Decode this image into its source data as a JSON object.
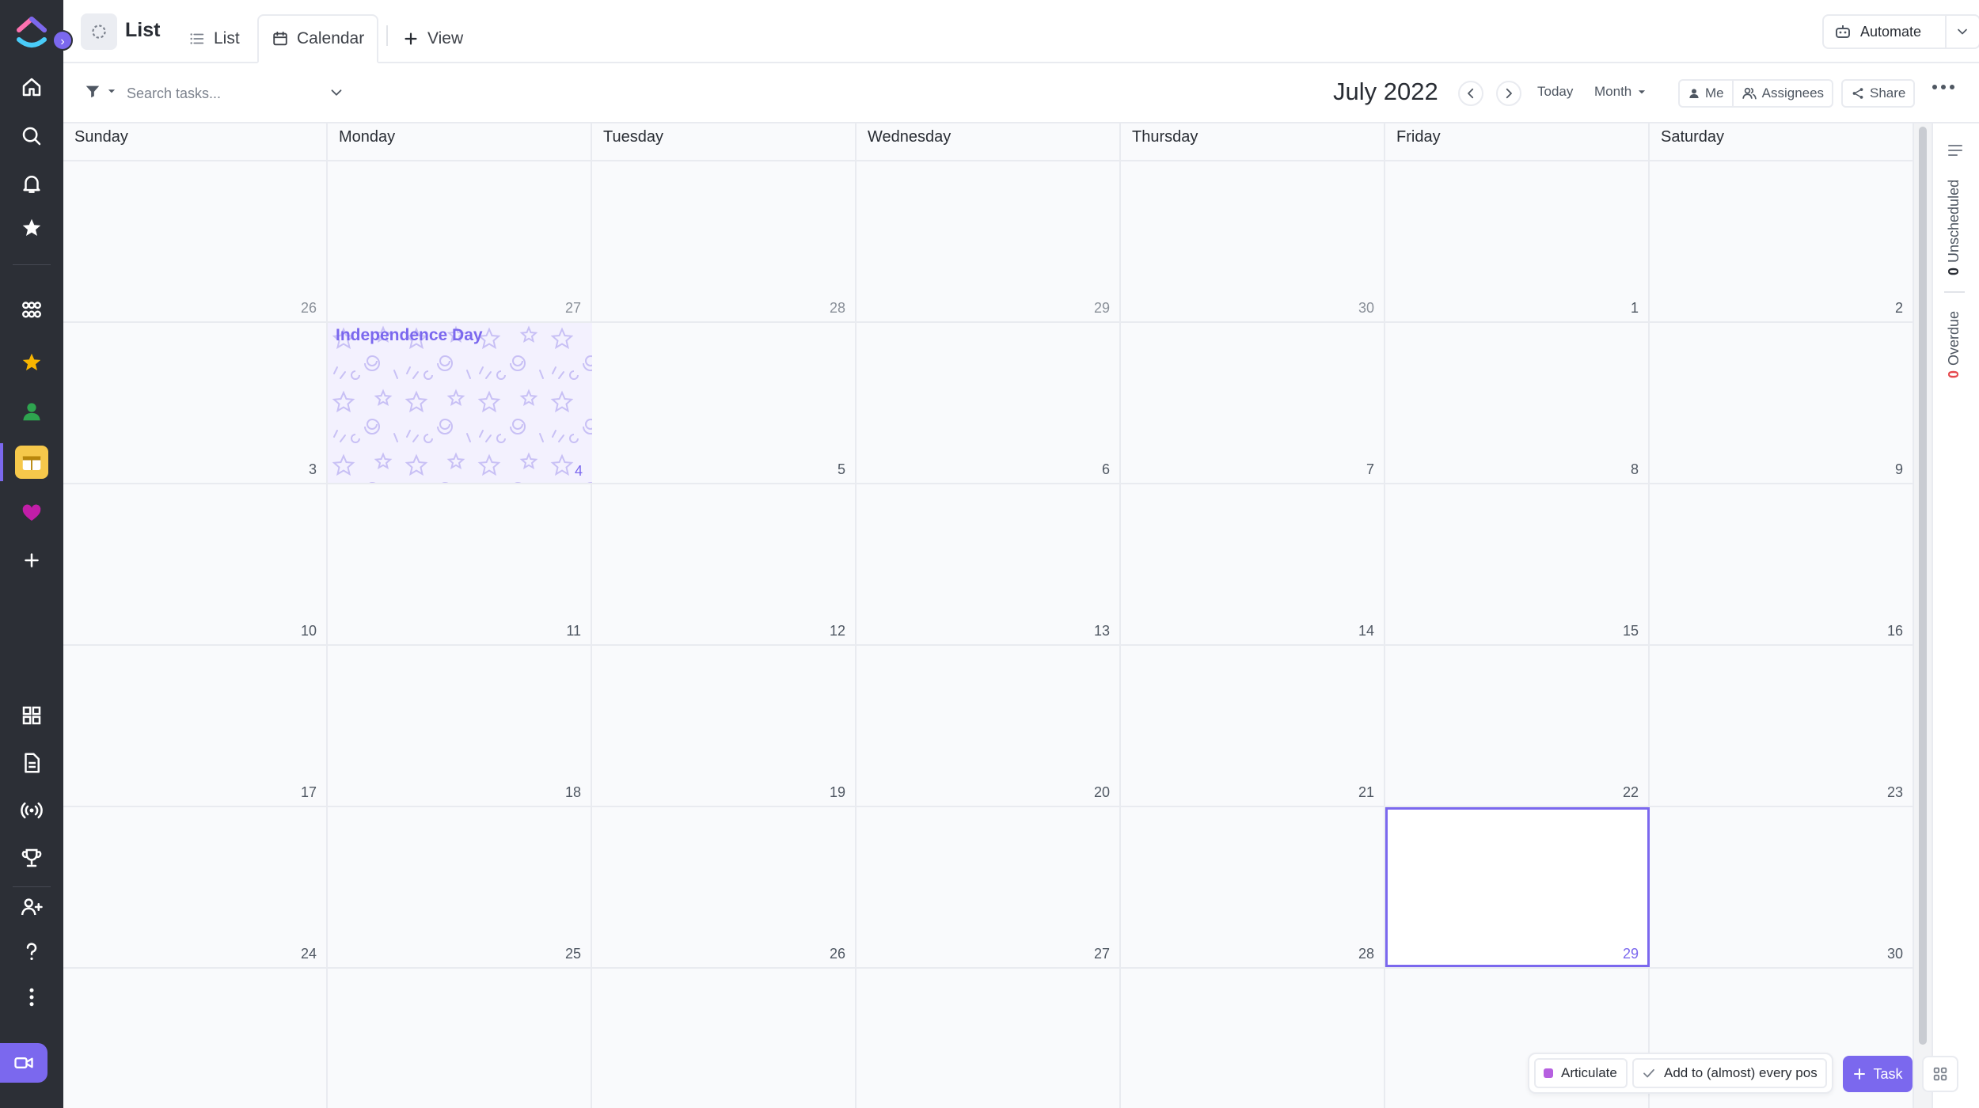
{
  "header": {
    "title": "List",
    "tabs": [
      {
        "label": "List",
        "icon": "list-icon"
      },
      {
        "label": "Calendar",
        "icon": "calendar-icon",
        "active": true
      },
      {
        "label": "View",
        "icon": "plus-icon"
      }
    ],
    "automate_label": "Automate"
  },
  "toolbar": {
    "search_placeholder": "Search tasks...",
    "month_title": "July 2022",
    "today_label": "Today",
    "range_label": "Month",
    "me_label": "Me",
    "assignees_label": "Assignees",
    "share_label": "Share"
  },
  "calendar": {
    "weekdays": [
      "Sunday",
      "Monday",
      "Tuesday",
      "Wednesday",
      "Thursday",
      "Friday",
      "Saturday"
    ],
    "weeks": [
      [
        "26",
        "27",
        "28",
        "29",
        "30",
        "1",
        "2"
      ],
      [
        "3",
        "4",
        "5",
        "6",
        "7",
        "8",
        "9"
      ],
      [
        "10",
        "11",
        "12",
        "13",
        "14",
        "15",
        "16"
      ],
      [
        "17",
        "18",
        "19",
        "20",
        "21",
        "22",
        "23"
      ],
      [
        "24",
        "25",
        "26",
        "27",
        "28",
        "29",
        "30"
      ]
    ],
    "holiday": {
      "name": "Independence Day",
      "day": "4"
    },
    "today": "29"
  },
  "right_panel": {
    "unscheduled_count": "0",
    "unscheduled_label": "Unscheduled",
    "overdue_count": "0",
    "overdue_label": "Overdue"
  },
  "tray": {
    "chip1": "Articulate",
    "chip2": "Add to (almost) every pos",
    "task_button": "Task"
  },
  "colors": {
    "accent": "#7b68ee",
    "rail_bg": "#2c2f36",
    "holiday_bg": "#f3f1fe",
    "overdue": "#e5484d"
  }
}
